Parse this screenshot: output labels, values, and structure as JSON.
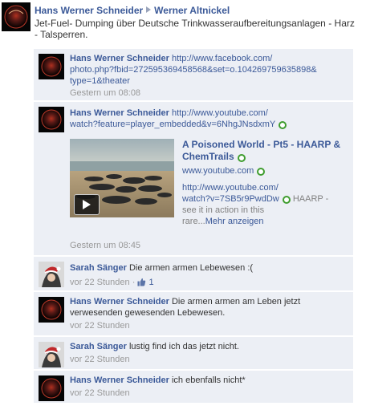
{
  "post": {
    "author": "Hans Werner Schneider",
    "target": "Werner Altnickel",
    "message": "Jet-Fuel- Dumping über Deutsche Trinkwasseraufbereitungsanlagen - Harz - Talsperren."
  },
  "comments": [
    {
      "author": "Hans Werner Schneider",
      "link_lines": [
        "http://www.facebook.com/",
        "photo.php?fbid=272595369458568&set=o.104269759635898&",
        "type=1&theater"
      ],
      "time": "Gestern um 08:08"
    },
    {
      "author": "Hans Werner Schneider",
      "link_lines": [
        "http://www.youtube.com/",
        "watch?feature=player_embedded&v=6NhgJNsdxmY"
      ],
      "share": {
        "title_lines": [
          "A Poisoned World - Pt5 - HAARP &",
          "ChemTrails"
        ],
        "domain": "www.youtube.com",
        "url_lines": [
          "http://www.youtube.com/",
          "watch?v=7SB5r9PwdDw"
        ],
        "desc": [
          "HAARP -",
          "see it in action in this",
          "rare..."
        ],
        "more": "Mehr anzeigen"
      },
      "time": "Gestern um 08:45"
    },
    {
      "author": "Sarah Sänger",
      "text": "Die armen armen Lebewesen :(",
      "time": "vor 22 Stunden",
      "separator": "·",
      "likes": "1"
    },
    {
      "author": "Hans Werner Schneider",
      "text_lines": [
        "Die armen armen am Leben jetzt",
        "verwesenden gewesenden Lebewesen."
      ],
      "time": "vor 22 Stunden"
    },
    {
      "author": "Sarah Sänger",
      "text": "lustig find ich das jetzt nicht.",
      "time": "vor 22 Stunden"
    },
    {
      "author": "Hans Werner Schneider",
      "text": "ich ebenfalls nicht*",
      "time": "vor 22 Stunden"
    }
  ],
  "colors": {
    "link": "#3b5998",
    "comment_bg": "#eceff5",
    "meta": "#999999",
    "green": "#3f9d2f"
  }
}
